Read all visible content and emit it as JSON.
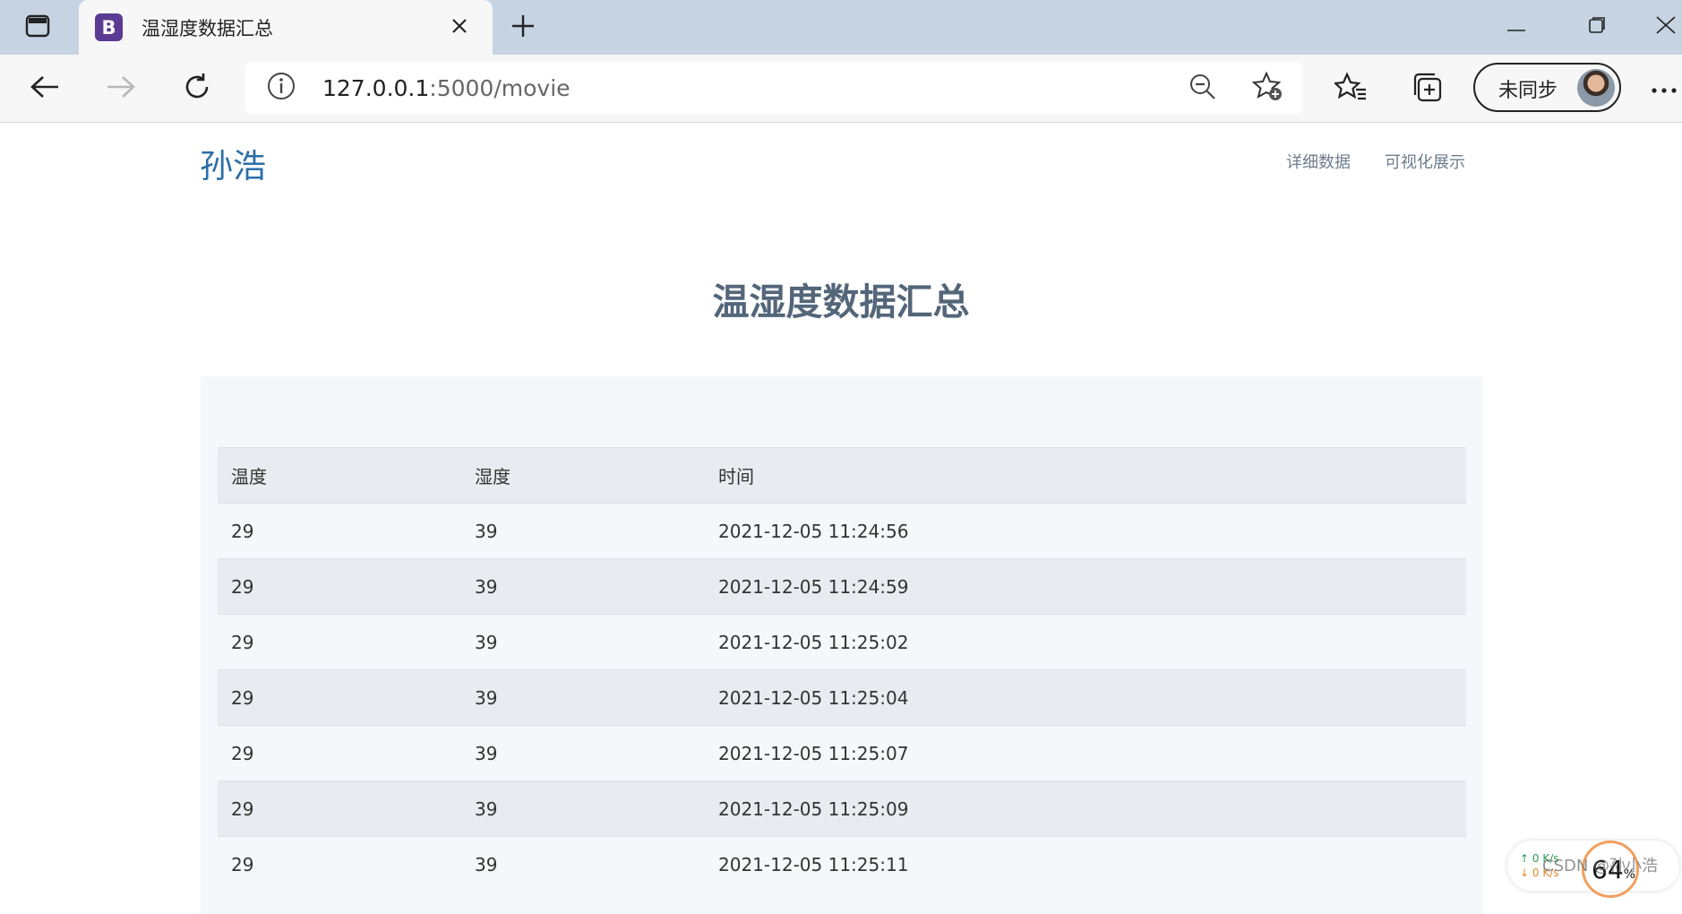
{
  "browser": {
    "tab": {
      "favicon_letter": "B",
      "title": "温湿度数据汇总"
    },
    "address": {
      "host": "127.0.0.1",
      "path": ":5000/movie"
    },
    "sync_label": "未同步"
  },
  "site": {
    "brand": "孙浩",
    "nav": [
      "详细数据",
      "可视化展示"
    ]
  },
  "page": {
    "heading": "温湿度数据汇总",
    "table": {
      "columns": [
        "温度",
        "湿度",
        "时间"
      ],
      "rows": [
        [
          "29",
          "39",
          "2021-12-05 11:24:56"
        ],
        [
          "29",
          "39",
          "2021-12-05 11:24:59"
        ],
        [
          "29",
          "39",
          "2021-12-05 11:25:02"
        ],
        [
          "29",
          "39",
          "2021-12-05 11:25:04"
        ],
        [
          "29",
          "39",
          "2021-12-05 11:25:07"
        ],
        [
          "29",
          "39",
          "2021-12-05 11:25:09"
        ],
        [
          "29",
          "39",
          "2021-12-05 11:25:11"
        ]
      ]
    }
  },
  "overlay": {
    "net_up": "0 K/s",
    "net_down": "0 K/s",
    "cpu_value": "64",
    "cpu_unit": "%",
    "watermark": "CSDN @孙小浩"
  }
}
